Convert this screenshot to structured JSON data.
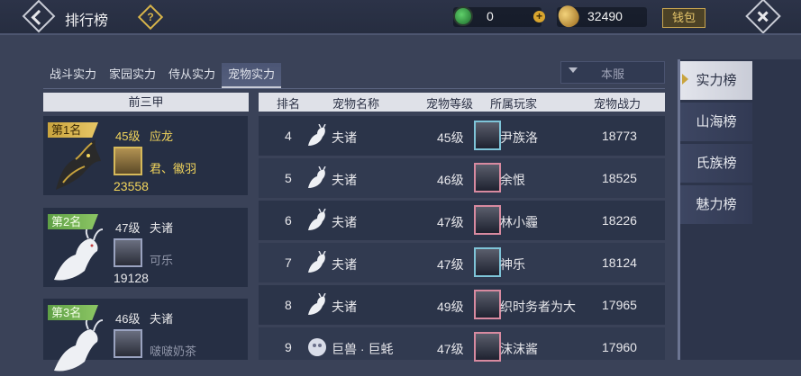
{
  "header": {
    "title": "排行榜",
    "help_symbol": "?",
    "jade_amount": "0",
    "add_symbol": "+",
    "coin_amount": "32490",
    "wallet_label": "钱包"
  },
  "tabs": [
    {
      "label": "战斗实力",
      "active": false
    },
    {
      "label": "家园实力",
      "active": false
    },
    {
      "label": "侍从实力",
      "active": false
    },
    {
      "label": "宠物实力",
      "active": true
    }
  ],
  "server_filter": {
    "label": "本服"
  },
  "top3": {
    "header": "前三甲",
    "cards": [
      {
        "rank": "第1名",
        "level": "45级",
        "pet": "应龙",
        "player": "君、徽羽",
        "power": "23558"
      },
      {
        "rank": "第2名",
        "level": "47级",
        "pet": "夫诸",
        "player": "可乐",
        "power": "19128"
      },
      {
        "rank": "第3名",
        "level": "46级",
        "pet": "夫诸",
        "player": "啵啵奶茶",
        "power": ""
      }
    ]
  },
  "table": {
    "columns": [
      "排名",
      "宠物名称",
      "宠物等级",
      "所属玩家",
      "宠物战力"
    ],
    "rows": [
      {
        "rank": "4",
        "pet": "夫诸",
        "level": "45级",
        "player": "尹族洛",
        "power": "18773"
      },
      {
        "rank": "5",
        "pet": "夫诸",
        "level": "46级",
        "player": "余恨",
        "power": "18525"
      },
      {
        "rank": "6",
        "pet": "夫诸",
        "level": "47级",
        "player": "林小霾",
        "power": "18226"
      },
      {
        "rank": "7",
        "pet": "夫诸",
        "level": "47级",
        "player": "神乐",
        "power": "18124"
      },
      {
        "rank": "8",
        "pet": "夫诸",
        "level": "49级",
        "player": "织时务者为大",
        "power": "17965"
      },
      {
        "rank": "9",
        "pet": "巨兽 · 巨蚝",
        "level": "47级",
        "player": "沫沫酱",
        "power": "17960"
      }
    ]
  },
  "sidebar": {
    "items": [
      {
        "label": "实力榜",
        "active": true
      },
      {
        "label": "山海榜",
        "active": false
      },
      {
        "label": "氏族榜",
        "active": false
      },
      {
        "label": "魅力榜",
        "active": false
      }
    ]
  },
  "colors": {
    "accent_gold": "#f2d55c",
    "background": "#3a4258"
  }
}
